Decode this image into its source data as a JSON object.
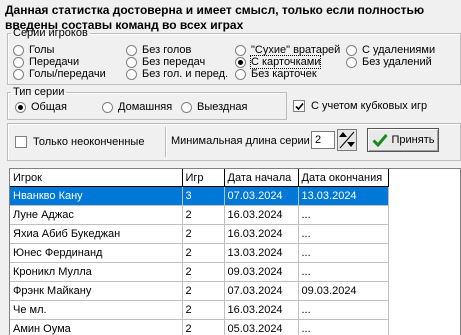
{
  "title": "Данная статистка достоверна и имеет смысл, только если полностью введены составы команд во всех играх",
  "series_group": {
    "legend": "Серии игроков",
    "options": [
      {
        "label": "Голы",
        "selected": false
      },
      {
        "label": "Без голов",
        "selected": false
      },
      {
        "label": "\"Сухие\" вратарей",
        "selected": false
      },
      {
        "label": "С удалениями",
        "selected": false
      },
      {
        "label": "Передачи",
        "selected": false
      },
      {
        "label": "Без передач",
        "selected": false
      },
      {
        "label": "С карточками",
        "selected": true
      },
      {
        "label": "Без удалений",
        "selected": false
      },
      {
        "label": "Голы/передачи",
        "selected": false
      },
      {
        "label": "Без гол. и перед.",
        "selected": false
      },
      {
        "label": "Без карточек",
        "selected": false
      }
    ]
  },
  "type_group": {
    "legend": "Тип серии",
    "options": [
      {
        "label": "Общая",
        "selected": true
      },
      {
        "label": "Домашняя",
        "selected": false
      },
      {
        "label": "Выездная",
        "selected": false
      }
    ],
    "cup_games_label": "С учетом кубковых игр",
    "cup_games_checked": true
  },
  "filter": {
    "unfinished_label": "Только неоконченные",
    "unfinished_checked": false,
    "min_length_label": "Минимальная длина серии",
    "min_length_value": "2",
    "accept_label": "Принять"
  },
  "table": {
    "columns": [
      "Игрок",
      "Игр",
      "Дата начала",
      "Дата окончания"
    ],
    "rows": [
      [
        "Нванкво Кану",
        "3",
        "07.03.2024",
        "13.03.2024"
      ],
      [
        "Луне Аджас",
        "2",
        "16.03.2024",
        "..."
      ],
      [
        "Яхиа Абиб Букеджан",
        "2",
        "16.03.2024",
        "..."
      ],
      [
        "Юнес Фердинанд",
        "2",
        "13.03.2024",
        "..."
      ],
      [
        "Кроникл Мулла",
        "2",
        "09.03.2024",
        "..."
      ],
      [
        "Фрэнк Майкану",
        "2",
        "07.03.2024",
        "09.03.2024"
      ],
      [
        "Че мл.",
        "2",
        "16.03.2024",
        "..."
      ],
      [
        "Амин Оума",
        "2",
        "05.03.2024",
        "..."
      ]
    ],
    "selected_row": 0
  },
  "colors": {
    "selection": "#0078d7",
    "accept_icon": "#1a8a1a"
  }
}
